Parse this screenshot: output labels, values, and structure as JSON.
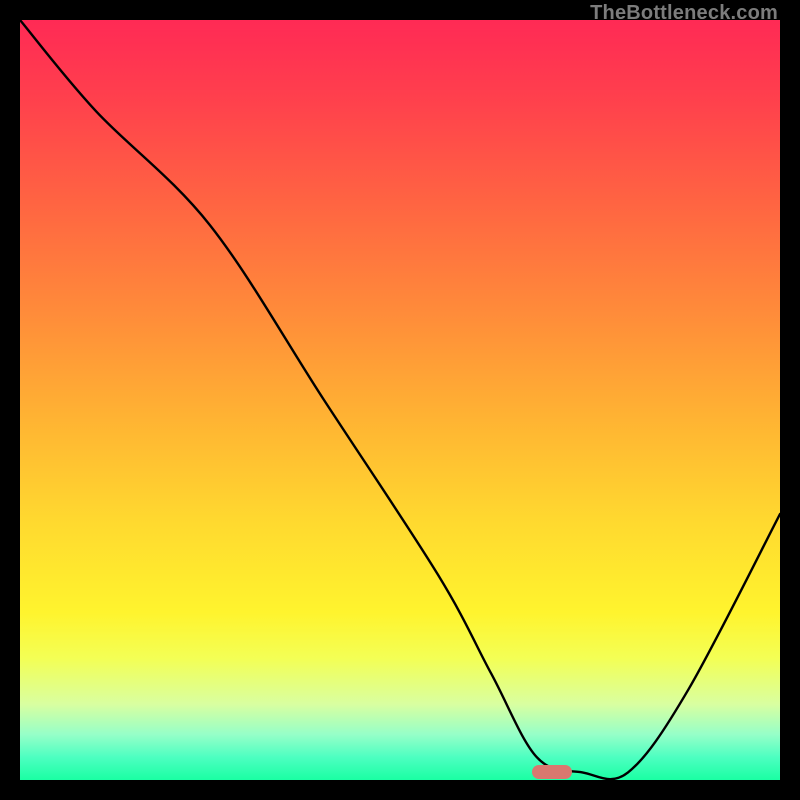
{
  "watermark": "TheBottleneck.com",
  "marker": {
    "x_pct": 70,
    "y_pct": 99
  },
  "chart_data": {
    "type": "line",
    "title": "",
    "xlabel": "",
    "ylabel": "",
    "xlim": [
      0,
      100
    ],
    "ylim": [
      0,
      100
    ],
    "series": [
      {
        "name": "bottleneck-curve",
        "x": [
          0,
          10,
          25,
          40,
          55,
          62,
          68,
          74,
          80,
          88,
          100
        ],
        "y": [
          100,
          88,
          73,
          50,
          27,
          14,
          3,
          1,
          1,
          12,
          35
        ]
      }
    ],
    "annotations": [
      {
        "name": "optimal-marker",
        "x": 70,
        "y": 1
      }
    ],
    "background_gradient": {
      "top": "#ff2a55",
      "mid": "#ffd92f",
      "bottom": "#1affa3"
    }
  }
}
